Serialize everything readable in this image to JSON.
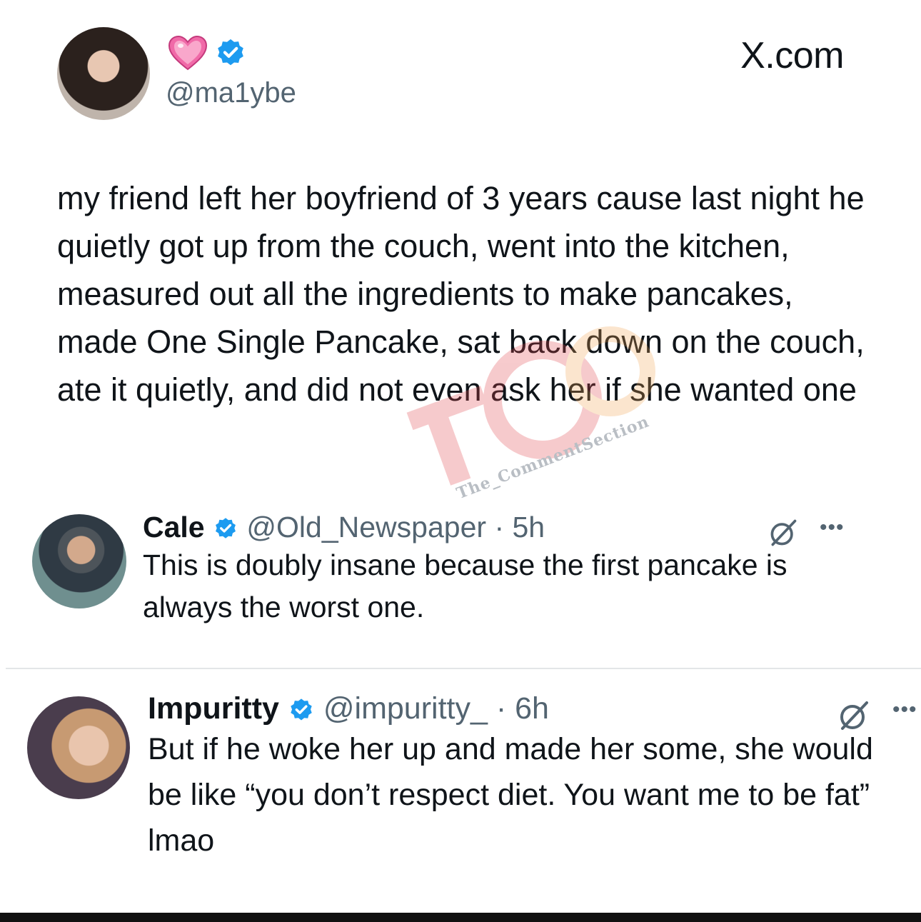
{
  "post": {
    "handle": "@ma1ybe",
    "site_label": "X.com",
    "text": "my friend left her boyfriend of 3 years cause last night he quietly got up from the couch, went into the kitchen, measured out all the ingredients to make pancakes, made One Single Pancake, sat back down on the couch, ate it quietly, and did not even ask her if she wanted one"
  },
  "watermark": {
    "text": "The_CommentSection"
  },
  "replies": [
    {
      "name": "Cale",
      "handle": "@Old_Newspaper",
      "time": "· 5h",
      "text": "This is doubly insane because the first pancake is always the worst one."
    },
    {
      "name": "Impuritty",
      "handle": "@impuritty_",
      "time": "· 6h",
      "text": "But if he woke her up and made her some, she would be like “you don’t respect diet. You want me to be fat” lmao"
    }
  ],
  "icons": {
    "heart": "pink-heart-emoji",
    "verified": "verified-badge-icon",
    "grok": "grok-icon",
    "more": "more-icon"
  },
  "colors": {
    "verified_blue": "#1d9bf0",
    "text_primary": "#0f1419",
    "text_secondary": "#536471",
    "heart_pink": "#f26aa9"
  }
}
